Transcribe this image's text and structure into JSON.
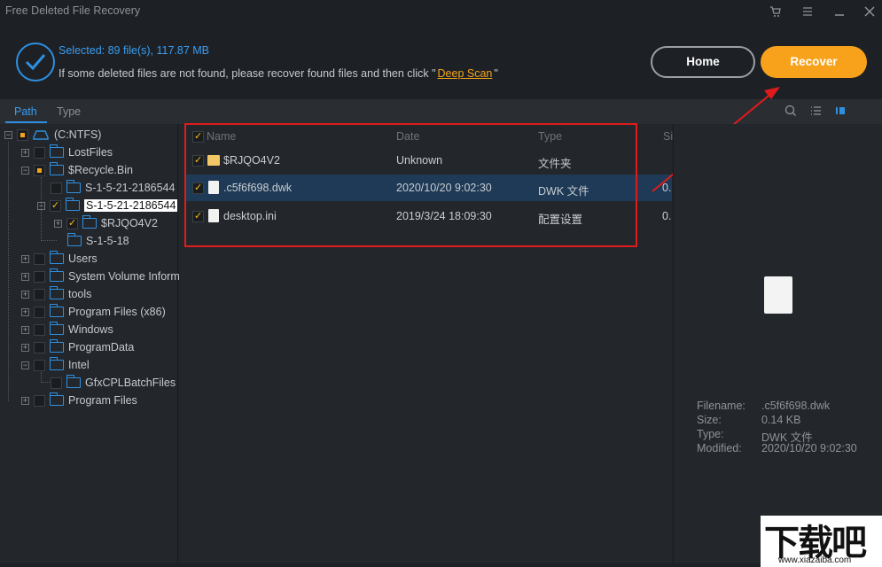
{
  "app": {
    "title": "Free Deleted File Recovery"
  },
  "header": {
    "selected": "Selected: 89 file(s), 117.87 MB",
    "hint_prefix": "If some deleted files are not found, please recover found files and then click \"",
    "deep_scan": "Deep Scan",
    "hint_suffix": "\"",
    "home_label": "Home",
    "recover_label": "Recover"
  },
  "tabs": [
    "Path",
    "Type"
  ],
  "tree": [
    {
      "label": "(C:NTFS)"
    },
    {
      "label": "LostFiles"
    },
    {
      "label": "$Recycle.Bin"
    },
    {
      "label": "S-1-5-21-2186544"
    },
    {
      "label": "S-1-5-21-2186544"
    },
    {
      "label": "$RJQO4V2"
    },
    {
      "label": "S-1-5-18"
    },
    {
      "label": "Users"
    },
    {
      "label": "System Volume Inform"
    },
    {
      "label": "tools"
    },
    {
      "label": "Program Files (x86)"
    },
    {
      "label": "Windows"
    },
    {
      "label": "ProgramData"
    },
    {
      "label": "Intel"
    },
    {
      "label": "GfxCPLBatchFiles"
    },
    {
      "label": "Program Files"
    }
  ],
  "columns": {
    "name": "Name",
    "date": "Date",
    "type": "Type",
    "size": "Si"
  },
  "files": [
    {
      "name": "$RJQO4V2",
      "date": "Unknown",
      "type": "文件夹",
      "size": ""
    },
    {
      "name": ".c5f6f698.dwk",
      "date": "2020/10/20 9:02:30",
      "type": "DWK 文件",
      "size": "0."
    },
    {
      "name": "desktop.ini",
      "date": "2019/3/24 18:09:30",
      "type": "配置设置",
      "size": "0."
    }
  ],
  "details": {
    "filename_label": "Filename:",
    "filename": ".c5f6f698.dwk",
    "size_label": "Size:",
    "size": "0.14 KB",
    "type_label": "Type:",
    "type": "DWK 文件",
    "modified_label": "Modified:",
    "modified": "2020/10/20 9:02:30"
  },
  "watermark": {
    "big": "下载吧",
    "small": "www.xiazaiba.com"
  },
  "colors": {
    "accent": "#2e8fe0",
    "recover": "#f7a21a",
    "annotation": "#e01b1b"
  }
}
